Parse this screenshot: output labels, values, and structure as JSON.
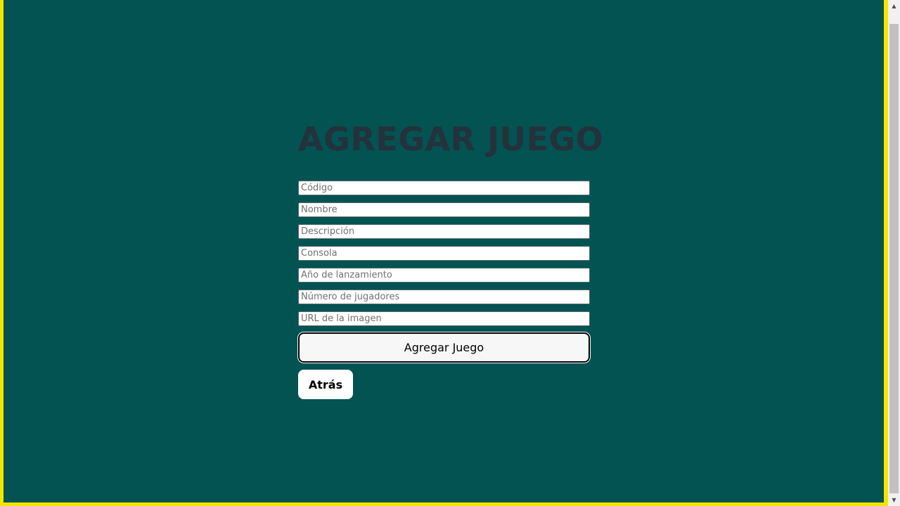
{
  "page": {
    "title": "AGREGAR JUEGO",
    "colors": {
      "background": "#035353",
      "frame": "#f2e600",
      "title": "#23323b"
    }
  },
  "form": {
    "fields": [
      {
        "name": "codigo",
        "placeholder": "Código",
        "value": ""
      },
      {
        "name": "nombre",
        "placeholder": "Nombre",
        "value": ""
      },
      {
        "name": "descripcion",
        "placeholder": "Descripción",
        "value": ""
      },
      {
        "name": "consola",
        "placeholder": "Consola",
        "value": ""
      },
      {
        "name": "anio",
        "placeholder": "Año de lanzamiento",
        "value": ""
      },
      {
        "name": "jugadores",
        "placeholder": "Número de jugadores",
        "value": ""
      },
      {
        "name": "imagen",
        "placeholder": "URL de la imagen",
        "value": ""
      }
    ],
    "submit_label": "Agregar Juego",
    "back_label": "Atrás"
  },
  "scrollbar": {
    "up_icon": "triangle-up-icon",
    "down_icon": "triangle-down-icon"
  }
}
